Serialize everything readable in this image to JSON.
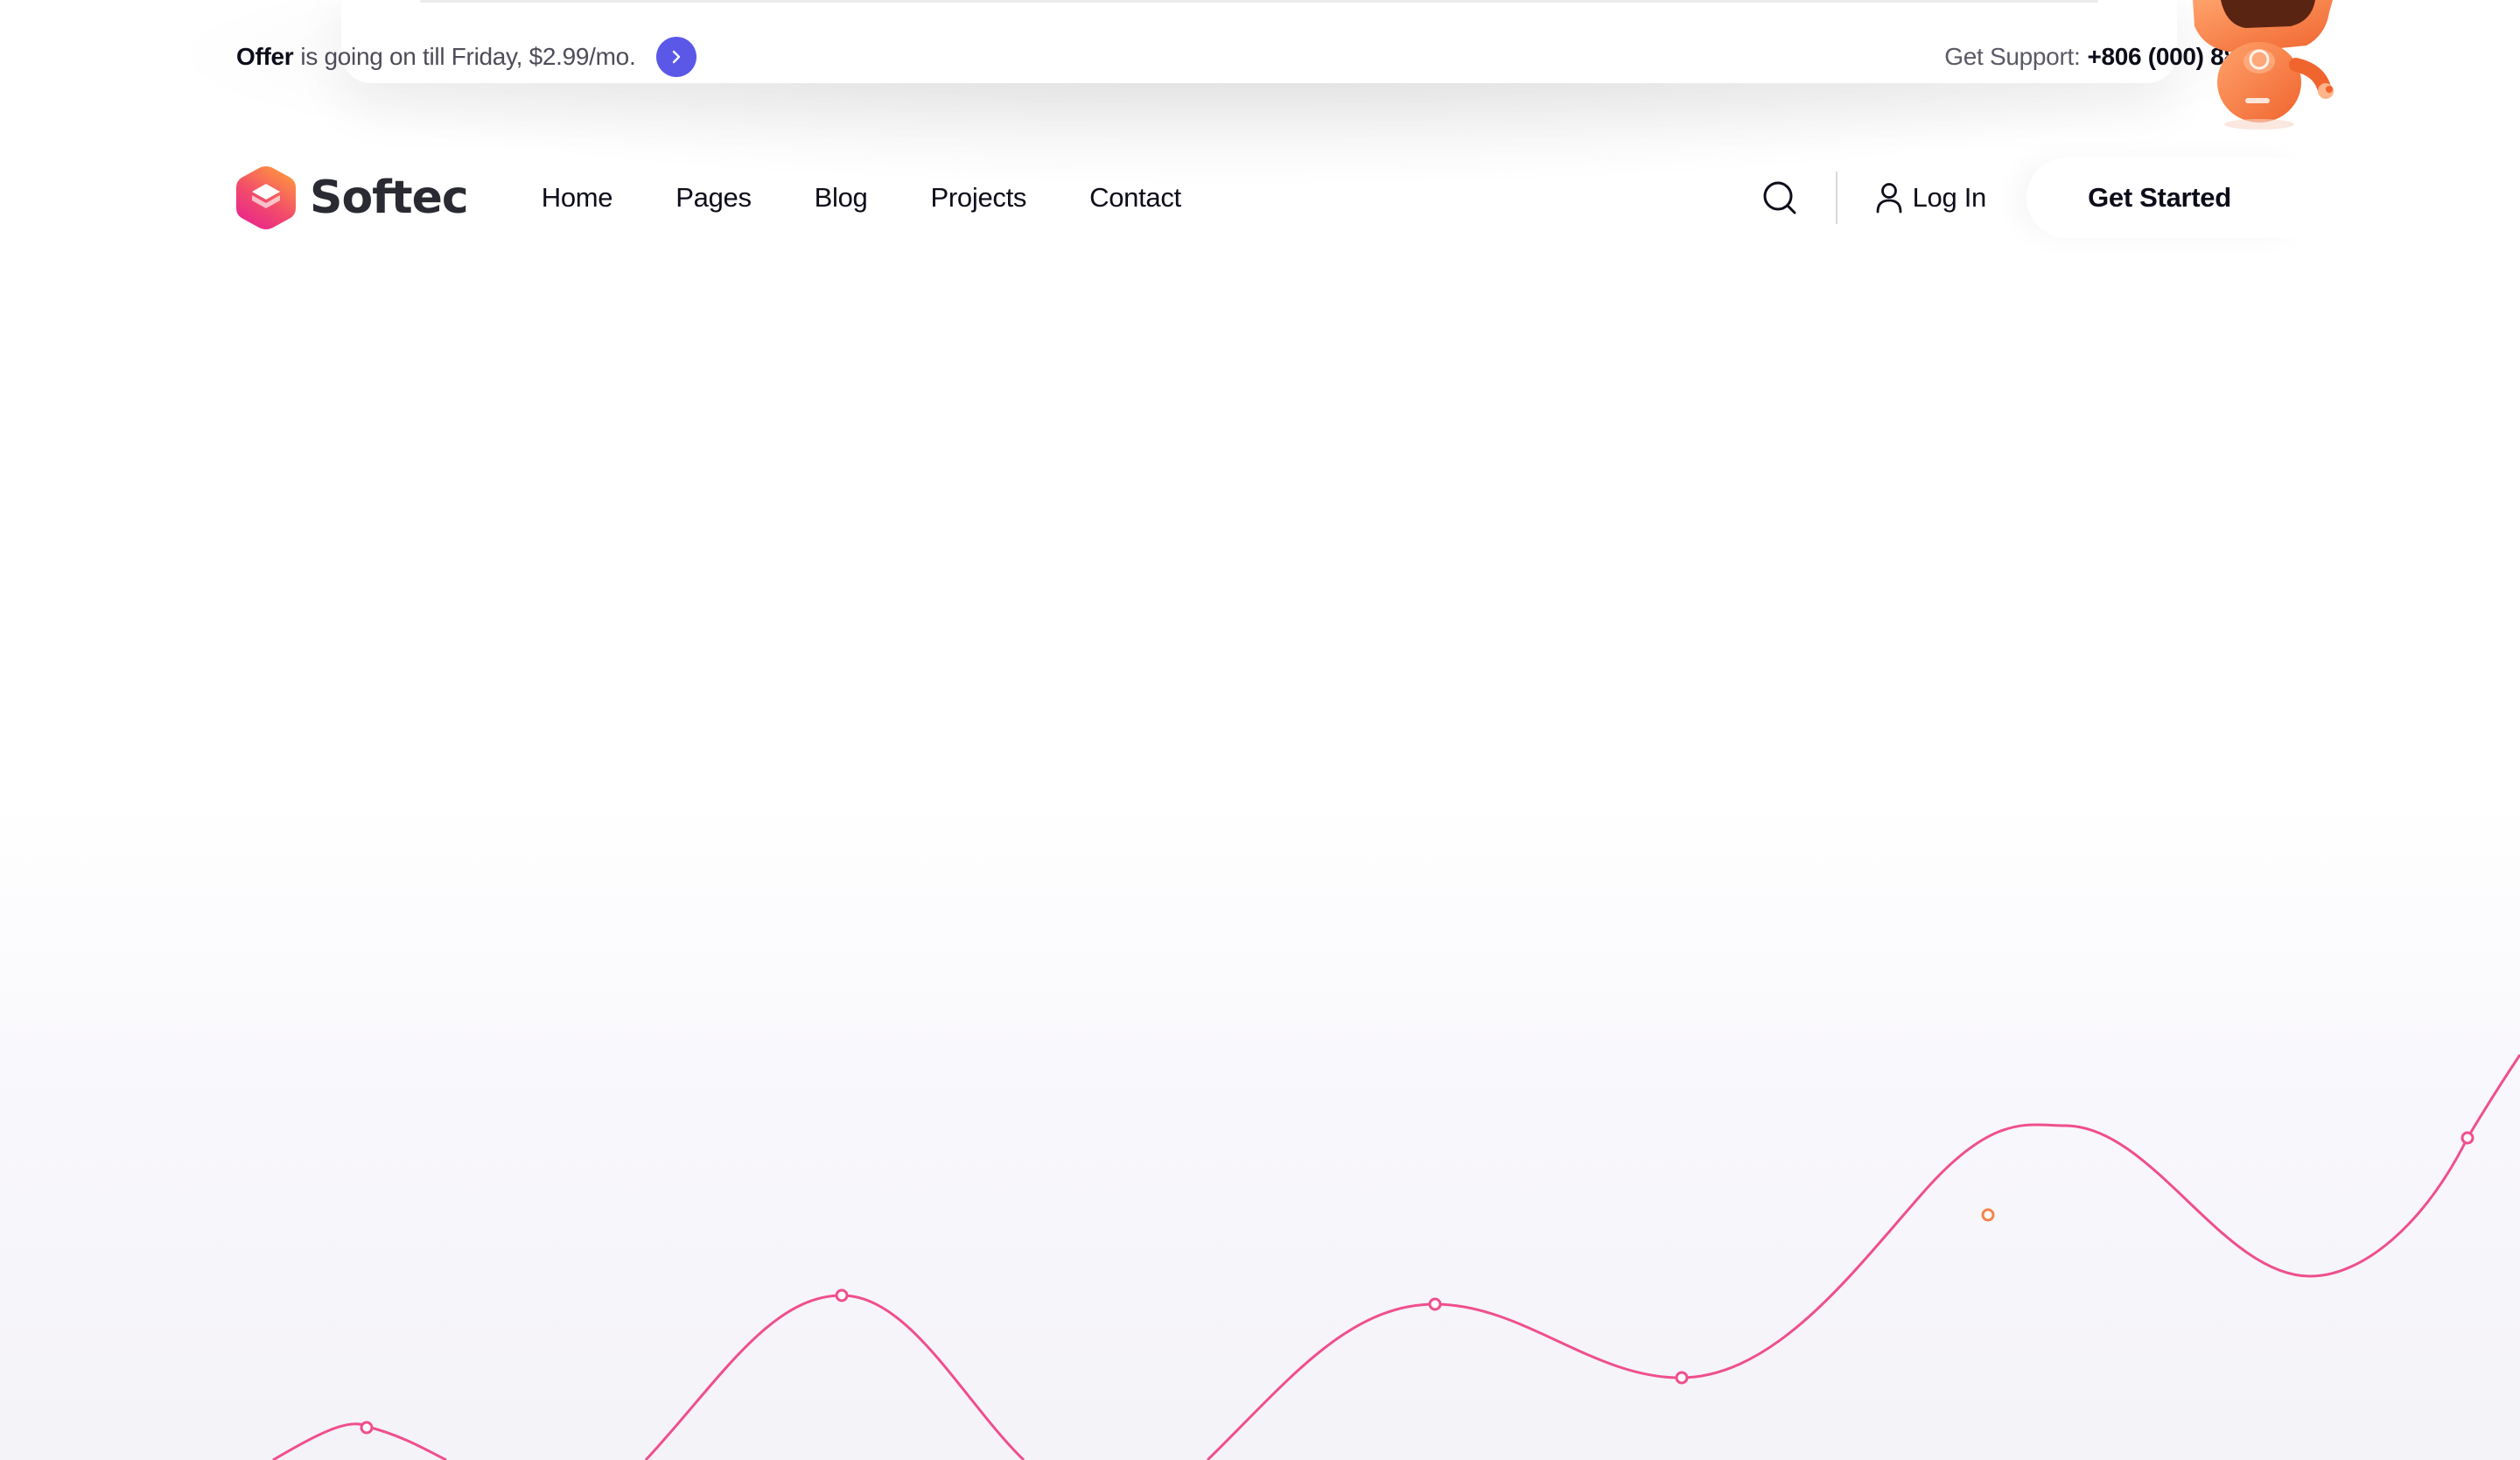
{
  "offer_bar": {
    "highlight": "Offer",
    "text": "is going on till Friday, $2.99/mo.",
    "support_label": "Get Support:",
    "support_phone": "+806 (000) 888 99"
  },
  "brand": {
    "name": "Softec",
    "colors": {
      "logo_top": "#ff9a3d",
      "logo_bottom": "#e8248f",
      "accent": "#5b58e8",
      "wave": "#ef4f8e",
      "wave_point_alt": "#f2844c"
    }
  },
  "nav": {
    "items": [
      {
        "label": "Home"
      },
      {
        "label": "Pages"
      },
      {
        "label": "Blog"
      },
      {
        "label": "Projects"
      },
      {
        "label": "Contact"
      }
    ],
    "login_label": "Log In",
    "cta_label": "Get Started"
  },
  "icons": {
    "offer_arrow": "chevron-right-icon",
    "search": "search-icon",
    "user": "user-icon"
  }
}
